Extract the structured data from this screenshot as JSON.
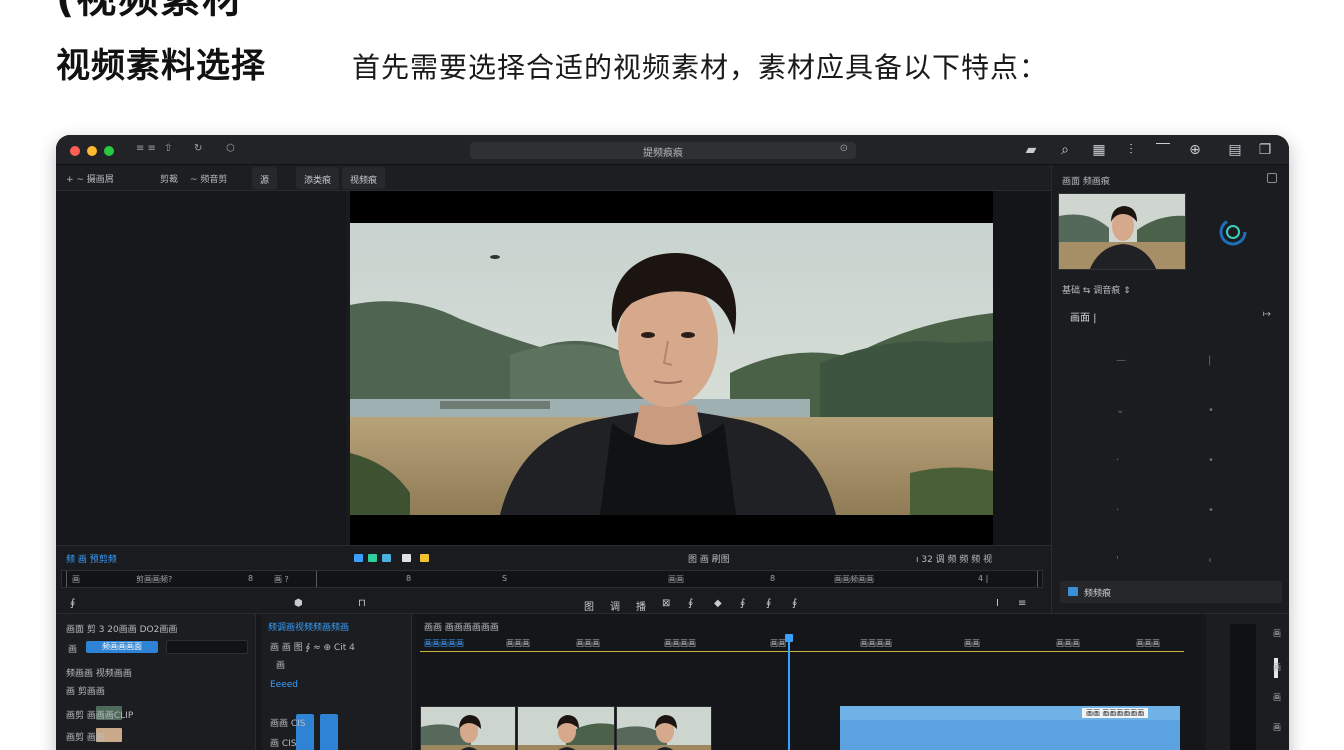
{
  "slide": {
    "top_title": "(视频素材",
    "heading": "视频素料选择",
    "description": "首先需要选择合适的视频素材，素材应具备以下特点："
  },
  "window": {
    "title": "提频痕痕",
    "toolbar_left": [
      "≡ ≡",
      "⇧",
      "↻",
      "⬡"
    ],
    "toolbar_items": [
      "+ ~ 摄画屑",
      "剪裁",
      "~ 频音剪"
    ],
    "toolbar_tabs": [
      "源",
      "添类痕",
      "视频痕"
    ],
    "colors": {
      "accent": "#3aa0ff",
      "bg": "#1a1b1e"
    }
  },
  "inspector": {
    "header": "画面 频画痕",
    "tabs": "基础  ⇆ 调音痕  ⇕",
    "row_label": "画面  |",
    "folder_label": "频频痕"
  },
  "transport": {
    "left_label": "频 画 预剪频",
    "center_label": "图 画 刷图",
    "right_label": "ı 32 调 频 频 频 视",
    "scrub_labels": [
      "画",
      "剪画画频?",
      "8",
      "画 ?",
      "8",
      "S",
      "画画",
      "8",
      "画画频画画",
      "4 |"
    ],
    "controls": [
      "∮",
      "⬢",
      "⊓",
      "图",
      "调",
      "播",
      "⊠",
      "∮",
      "◆",
      "∮",
      "∮",
      "∮",
      "I",
      "≡"
    ]
  },
  "library": {
    "header": "画面  剪 3 20画画  DO2画画",
    "button": "频画画画面",
    "rows": [
      "频画画   视频画画",
      "画   剪画画",
      "画剪   画画画CLIP",
      "画剪   画画"
    ]
  },
  "effects": {
    "tab": "频调画视频频画频画",
    "rows": [
      "画 画 图   ∮  ≈  ⊕  Cit 4",
      "画",
      "Eeeed",
      "画画   CIS",
      "画   CIS"
    ]
  },
  "timeline": {
    "header": "画画 画画画画画画",
    "ruler": [
      "画画画画画",
      "画画画",
      "画画画",
      "画画画画",
      "画画",
      "画画画画",
      "画画",
      "画画画",
      "画画画"
    ],
    "clip_label": "画画   画画画画画画"
  },
  "meter": {
    "labels": [
      "画",
      "画",
      "画",
      "画"
    ]
  }
}
